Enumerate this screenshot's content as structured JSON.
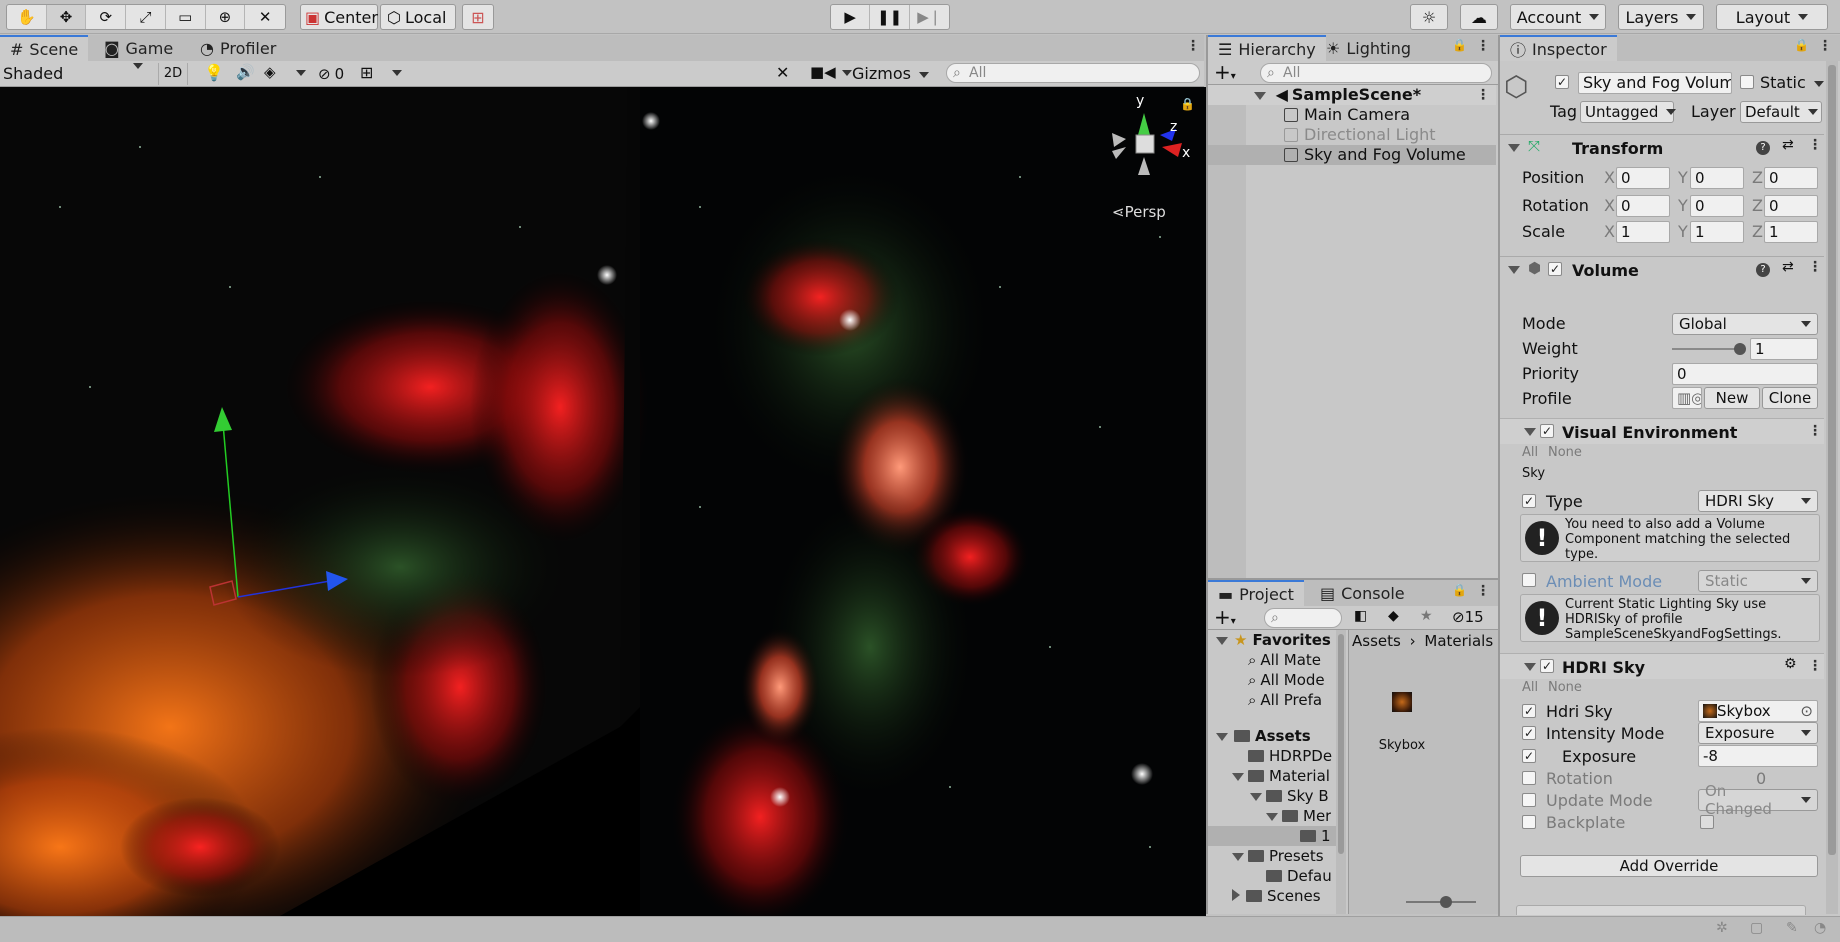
{
  "toolbar": {
    "pivot_label": "Center",
    "space_label": "Local",
    "account_label": "Account",
    "layers_label": "Layers",
    "layout_label": "Layout"
  },
  "scene_panel": {
    "tabs": [
      {
        "label": "Scene"
      },
      {
        "label": "Game"
      },
      {
        "label": "Profiler"
      }
    ],
    "shading_mode": "Shaded",
    "mode_2d": "2D",
    "hidden_count": "0",
    "gizmos_label": "Gizmos",
    "search_placeholder": "All",
    "persp_label": "Persp",
    "axis_labels": {
      "y": "y",
      "z": "z",
      "x": "x"
    }
  },
  "hierarchy": {
    "tabs": [
      {
        "label": "Hierarchy"
      },
      {
        "label": "Lighting"
      }
    ],
    "search_placeholder": "All",
    "scene_name": "SampleScene*",
    "items": [
      {
        "label": "Main Camera"
      },
      {
        "label": "Directional Light"
      },
      {
        "label": "Sky and Fog Volume"
      }
    ]
  },
  "project": {
    "tabs": [
      {
        "label": "Project"
      },
      {
        "label": "Console"
      }
    ],
    "hidden_count": "15",
    "favorites_label": "Favorites",
    "favorites": [
      {
        "label": "All Mate"
      },
      {
        "label": "All Mode"
      },
      {
        "label": "All Prefa"
      }
    ],
    "assets_label": "Assets",
    "tree": [
      {
        "label": "HDRPDe"
      },
      {
        "label": "Material"
      },
      {
        "label": "Sky B"
      },
      {
        "label": "Mer"
      },
      {
        "label": "1"
      },
      {
        "label": "Presets"
      },
      {
        "label": "Defau"
      },
      {
        "label": "Scenes"
      }
    ],
    "breadcrumb": [
      "Assets",
      "Materials"
    ],
    "asset_item": "Skybox"
  },
  "inspector": {
    "tab_label": "Inspector",
    "object_name": "Sky and Fog Volume",
    "static_label": "Static",
    "tag_label": "Tag",
    "tag_value": "Untagged",
    "layer_label": "Layer",
    "layer_value": "Default",
    "transform": {
      "title": "Transform",
      "rows": [
        {
          "label": "Position",
          "x": "0",
          "y": "0",
          "z": "0"
        },
        {
          "label": "Rotation",
          "x": "0",
          "y": "0",
          "z": "0"
        },
        {
          "label": "Scale",
          "x": "1",
          "y": "1",
          "z": "1"
        }
      ],
      "axis": {
        "x": "X",
        "y": "Y",
        "z": "Z"
      }
    },
    "volume": {
      "title": "Volume",
      "mode_label": "Mode",
      "mode_value": "Global",
      "weight_label": "Weight",
      "weight_value": "1",
      "weight_fraction": 1.0,
      "priority_label": "Priority",
      "priority_value": "0",
      "profile_label": "Profile",
      "new_label": "New",
      "clone_label": "Clone"
    },
    "visual_environment": {
      "title": "Visual Environment",
      "all_label": "All",
      "none_label": "None",
      "section_label": "Sky",
      "type_label": "Type",
      "type_value": "HDRI Sky",
      "warning_1": "You need to also add a Volume Component matching the selected type.",
      "ambient_label": "Ambient Mode",
      "ambient_value": "Static",
      "warning_2": "Current Static Lighting Sky use HDRISky of profile SampleSceneSkyandFogSettings."
    },
    "hdri_sky": {
      "title": "HDRI Sky",
      "all_label": "All",
      "none_label": "None",
      "hdri_label": "Hdri Sky",
      "hdri_value": "Skybox",
      "intensity_label": "Intensity Mode",
      "intensity_value": "Exposure",
      "exposure_label": "Exposure",
      "exposure_value": "-8",
      "rotation_label": "Rotation",
      "rotation_value": "0",
      "update_label": "Update Mode",
      "update_value": "On Changed",
      "backplate_label": "Backplate"
    },
    "add_override_label": "Add Override"
  },
  "colors": {
    "editor_bg": "#c2c2c2",
    "selection": "#b0b0b0",
    "active_tab_accent": "#3a79d7"
  }
}
